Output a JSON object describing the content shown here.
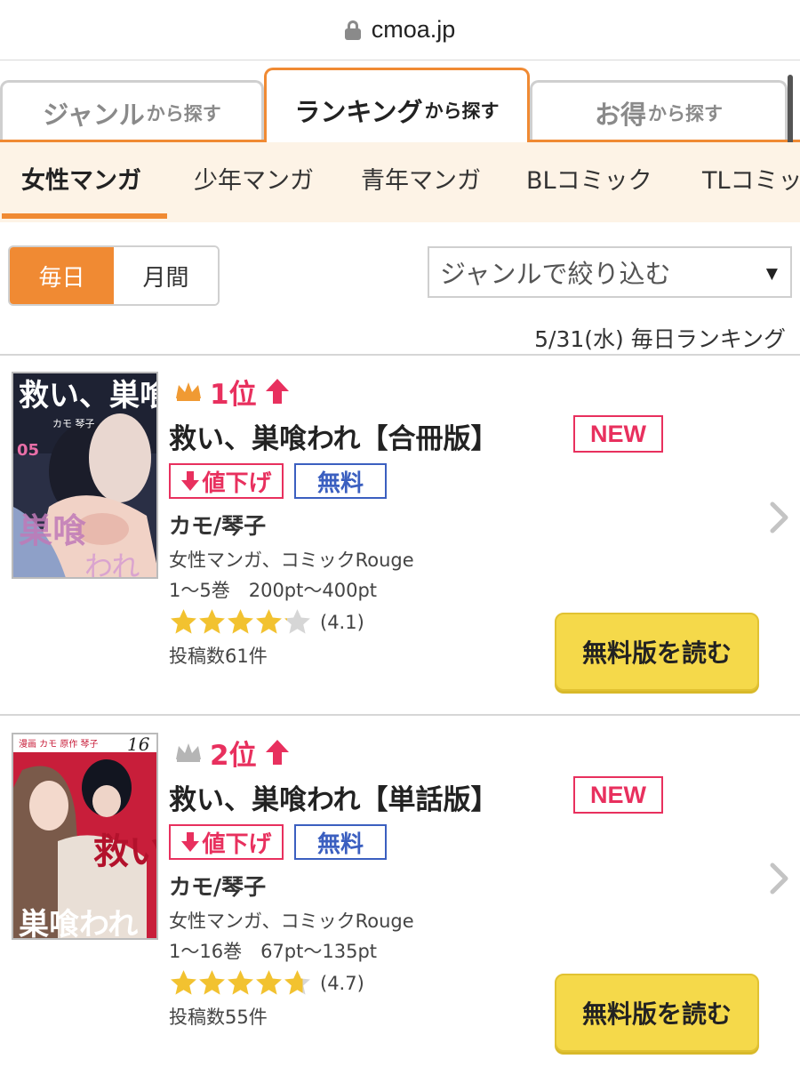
{
  "browser": {
    "url": "cmoa.jp"
  },
  "tabs": [
    {
      "main": "ジャンル",
      "suffix": "から探す"
    },
    {
      "main": "ランキング",
      "suffix": "から探す"
    },
    {
      "main": "お得",
      "suffix": "から探す"
    }
  ],
  "categories": [
    "女性マンガ",
    "少年マンガ",
    "青年マンガ",
    "BLコミック",
    "TLコミッ"
  ],
  "period": {
    "daily": "毎日",
    "monthly": "月間"
  },
  "genre_filter": {
    "label": "ジャンルで絞り込む",
    "caret": "▼"
  },
  "ranking_date": "5/31(水) 毎日ランキング",
  "entries": [
    {
      "rank": "1位",
      "crown_color": "#f09a33",
      "title": "救い、巣喰われ【合冊版】",
      "new_badge": "NEW",
      "price_down": "値下げ",
      "free_badge": "無料",
      "author": "カモ/琴子",
      "genres": "女性マンガ、コミックRouge",
      "volumes": "1〜5巻　200pt〜400pt",
      "rating": 4.1,
      "rating_text": "(4.1)",
      "reviews": "投稿数61件",
      "read_button": "無料版を読む",
      "cover_text": "救い、巣喰われ",
      "cover_credit": "カモ 琴子",
      "cover_volume": "05"
    },
    {
      "rank": "2位",
      "crown_color": "#b5b5b5",
      "title": "救い、巣喰われ【単話版】",
      "new_badge": "NEW",
      "price_down": "値下げ",
      "free_badge": "無料",
      "author": "カモ/琴子",
      "genres": "女性マンガ、コミックRouge",
      "volumes": "1〜16巻　67pt〜135pt",
      "rating": 4.7,
      "rating_text": "(4.7)",
      "reviews": "投稿数55件",
      "read_button": "無料版を読む",
      "cover_text": "救い、巣喰われ",
      "cover_credit": "漫画 カモ 原作 琴子",
      "cover_volume": "16"
    }
  ],
  "colors": {
    "accent": "#f08a33",
    "rank_red": "#e8305e",
    "free_blue": "#3b5fc0",
    "button_yellow": "#f5d94a",
    "star_gold": "#f2c230"
  }
}
